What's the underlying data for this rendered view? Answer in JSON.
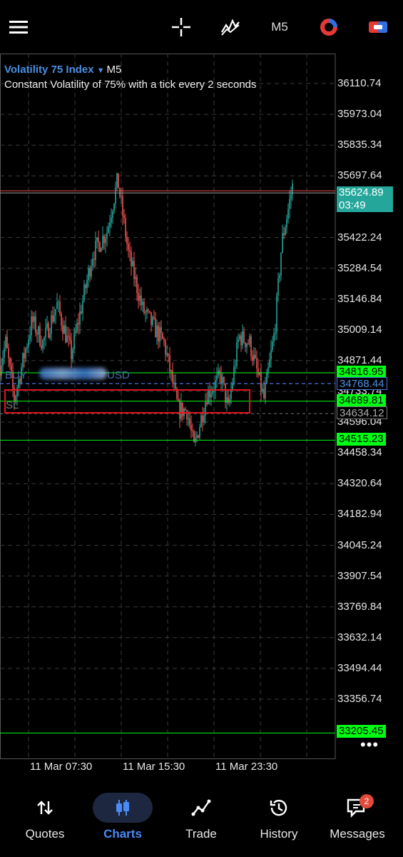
{
  "toolbar": {
    "timeframe": "M5"
  },
  "chart": {
    "symbol": "Volatility 75 Index",
    "symbol_timeframe": "M5",
    "description": "Constant Volatility of 75% with a tick every 2 seconds",
    "price_ticks": [
      "36110.74",
      "35973.04",
      "35835.34",
      "35697.64",
      "35422.24",
      "35284.54",
      "35146.84",
      "35009.14",
      "34871.44",
      "34733.74",
      "34596.04",
      "34458.34",
      "34320.64",
      "34182.94",
      "34045.24",
      "33907.54",
      "33769.84",
      "33632.14",
      "33494.44",
      "33356.74"
    ],
    "time_ticks": [
      "11 Mar 07:30",
      "11 Mar 15:30",
      "11 Mar 23:30"
    ],
    "bid_price": "35624.89",
    "bar_countdown": "03:49",
    "tp_price": "34816.95",
    "buy_entry_price": "34768.44",
    "sl_price": "34689.81",
    "pending_price": "34634.12",
    "level_price": "34515.23",
    "bottom_level_price": "33205.45",
    "buy_label_prefix": "BUY",
    "buy_label_suffix": "USD",
    "sl_label": "SL",
    "more": "•••",
    "colors": {
      "bull": "#26a69a",
      "bear": "#ef5350",
      "level_line": "#00ff14",
      "highlight_box": "#e3141e"
    }
  },
  "nav": {
    "quotes": "Quotes",
    "charts": "Charts",
    "trade": "Trade",
    "history": "History",
    "messages": "Messages",
    "messages_badge": "2",
    "active": "charts"
  }
}
